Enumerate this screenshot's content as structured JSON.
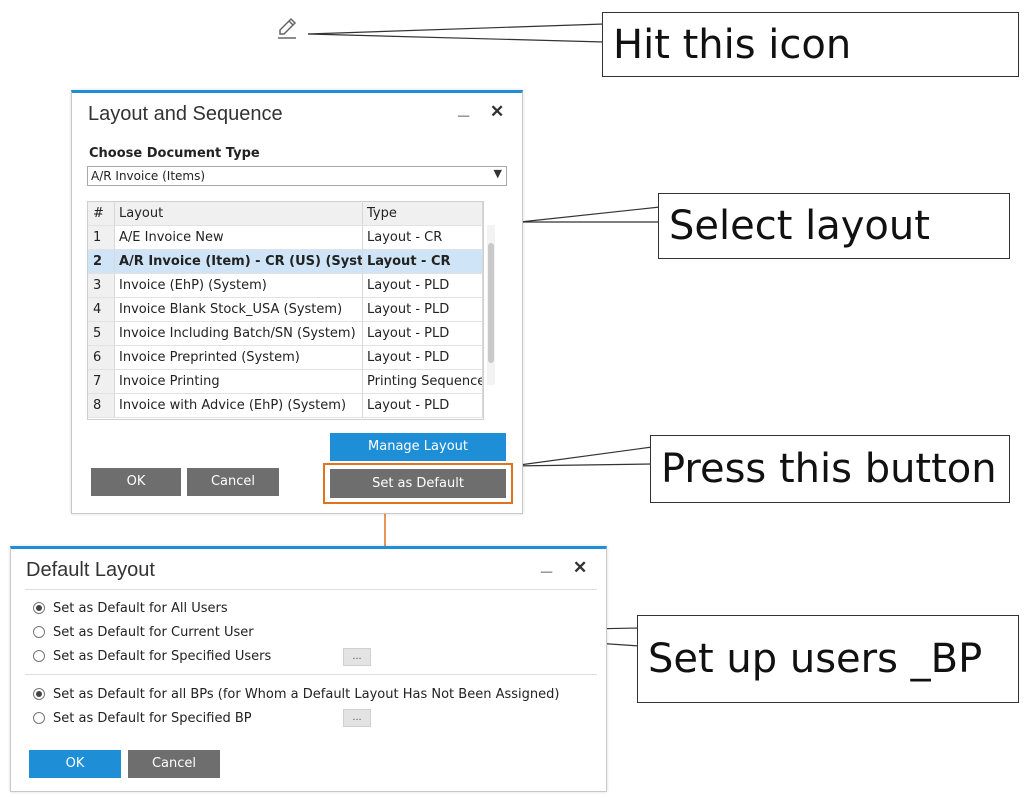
{
  "callouts": {
    "icon": "Hit this icon",
    "layout": "Select layout",
    "button": "Press this button",
    "users": "Set up users _BP"
  },
  "edit_icon": "pencil-edit-icon",
  "layout_dialog": {
    "title": "Layout and Sequence",
    "minimize": "_",
    "close": "✕",
    "doc_type_label": "Choose Document Type",
    "doc_type_value": "A/R Invoice (Items)",
    "columns": {
      "num": "#",
      "layout": "Layout",
      "type": "Type"
    },
    "rows": [
      {
        "num": "1",
        "layout": "A/E Invoice New",
        "type": "Layout - CR"
      },
      {
        "num": "2",
        "layout": "A/R Invoice (Item) - CR (US) (System)",
        "type": "Layout - CR"
      },
      {
        "num": "3",
        "layout": "Invoice (EhP) (System)",
        "type": "Layout - PLD"
      },
      {
        "num": "4",
        "layout": "Invoice Blank Stock_USA (System)",
        "type": "Layout - PLD"
      },
      {
        "num": "5",
        "layout": "Invoice Including Batch/SN (System)",
        "type": "Layout - PLD"
      },
      {
        "num": "6",
        "layout": "Invoice Preprinted (System)",
        "type": "Layout - PLD"
      },
      {
        "num": "7",
        "layout": "Invoice Printing",
        "type": "Printing Sequence"
      },
      {
        "num": "8",
        "layout": "Invoice with Advice (EhP) (System)",
        "type": "Layout - PLD"
      }
    ],
    "manage_layout": "Manage Layout",
    "ok": "OK",
    "cancel": "Cancel",
    "set_default": "Set as Default"
  },
  "default_dialog": {
    "title": "Default Layout",
    "minimize": "_",
    "close": "✕",
    "user_options": [
      {
        "label": "Set as Default for All Users",
        "checked": true
      },
      {
        "label": "Set as Default for Current User",
        "checked": false
      },
      {
        "label": "Set as Default for Specified Users",
        "checked": false
      }
    ],
    "bp_options": [
      {
        "label": "Set as Default for all BPs (for Whom a Default Layout Has Not Been Assigned)",
        "checked": true
      },
      {
        "label": "Set as Default for Specified BP",
        "checked": false
      }
    ],
    "dots": "...",
    "ok": "OK",
    "cancel": "Cancel"
  },
  "colors": {
    "accent_blue": "#1e8fd6",
    "highlight_orange": "#e0731c",
    "button_gray": "#6e6e6e"
  }
}
